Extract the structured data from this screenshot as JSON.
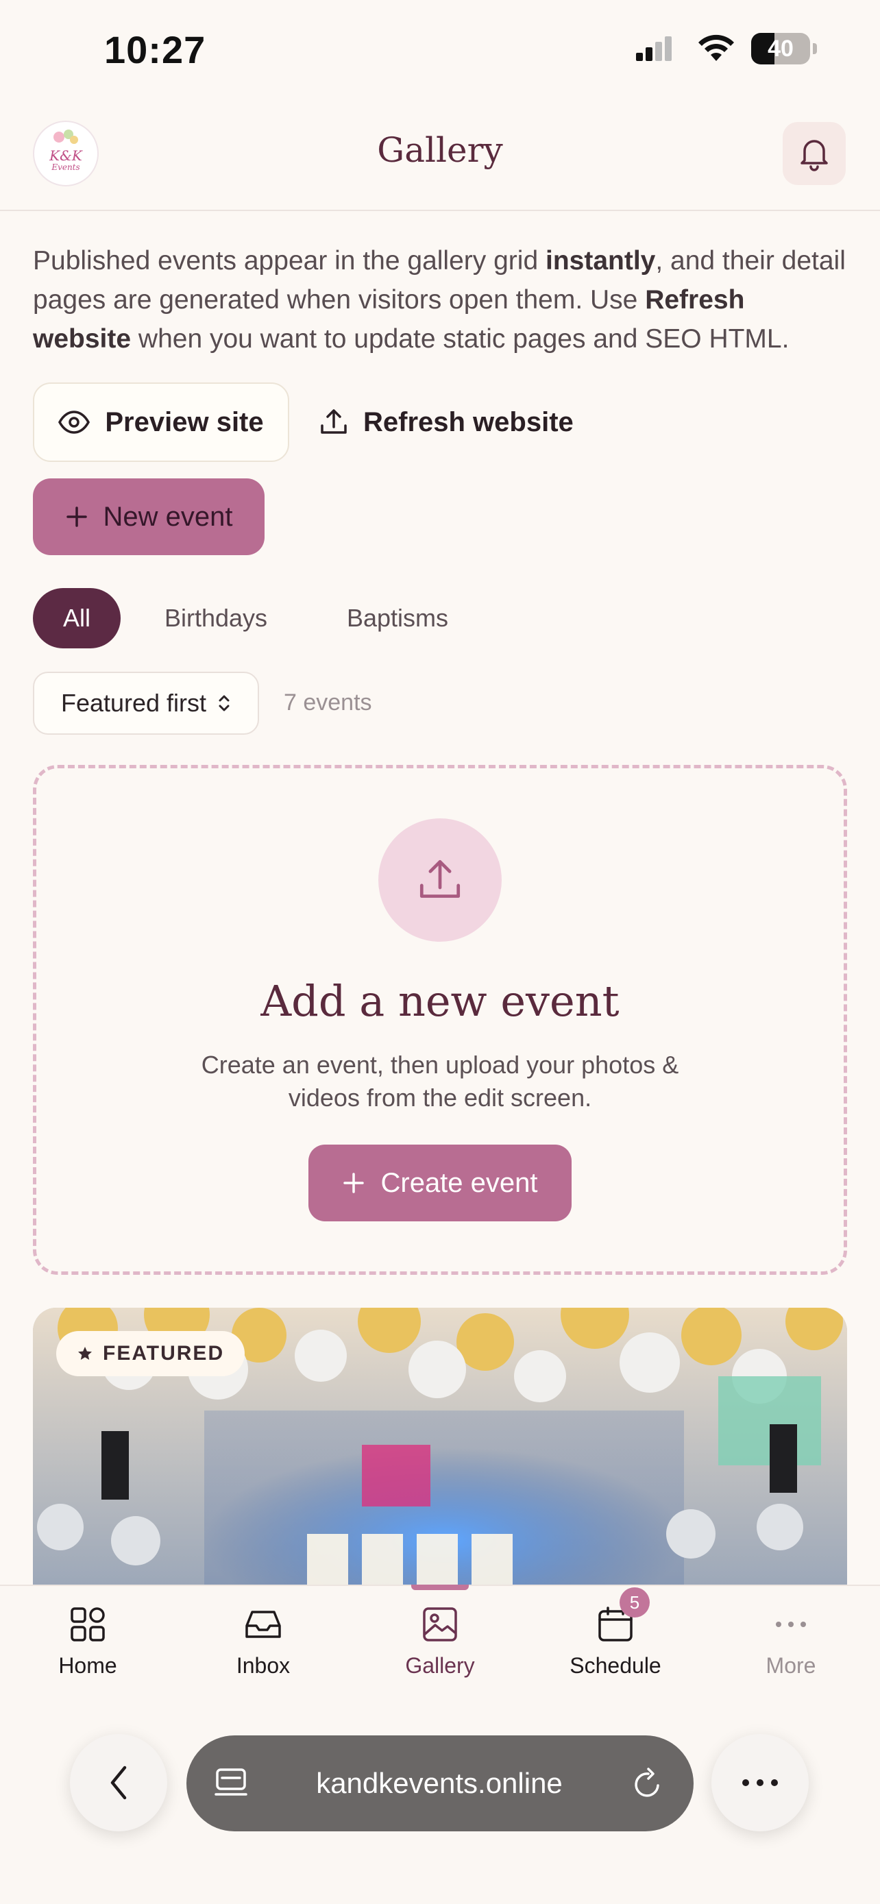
{
  "status_bar": {
    "time": "10:27",
    "battery": "40"
  },
  "header": {
    "title": "Gallery",
    "logo_text": "K & K Events"
  },
  "intro": {
    "part1": "Published events appear in the gallery grid ",
    "bold1": "instantly",
    "part2": ", and their detail pages are generated when visitors open them. Use ",
    "bold2": "Refresh website",
    "part3": " when you want to update static pages and SEO HTML."
  },
  "actions": {
    "preview_label": "Preview site",
    "refresh_label": "Refresh website",
    "new_event_label": "New event"
  },
  "filters": {
    "chips": [
      "All",
      "Birthdays",
      "Baptisms"
    ],
    "active": "All"
  },
  "sort": {
    "selected": "Featured first",
    "count_label": "7 events"
  },
  "upload_card": {
    "title": "Add a new event",
    "description": "Create an event, then upload your photos & videos from the edit screen.",
    "button_label": "Create event"
  },
  "event_card": {
    "badge": "FEATURED"
  },
  "tabbar": {
    "home": "Home",
    "inbox": "Inbox",
    "gallery": "Gallery",
    "schedule": "Schedule",
    "schedule_badge": "5",
    "more": "More"
  },
  "browser": {
    "url": "kandkevents.online"
  },
  "colors": {
    "accent": "#b86d92",
    "accent_dark": "#5c2a44",
    "background": "#fcf8f4"
  }
}
